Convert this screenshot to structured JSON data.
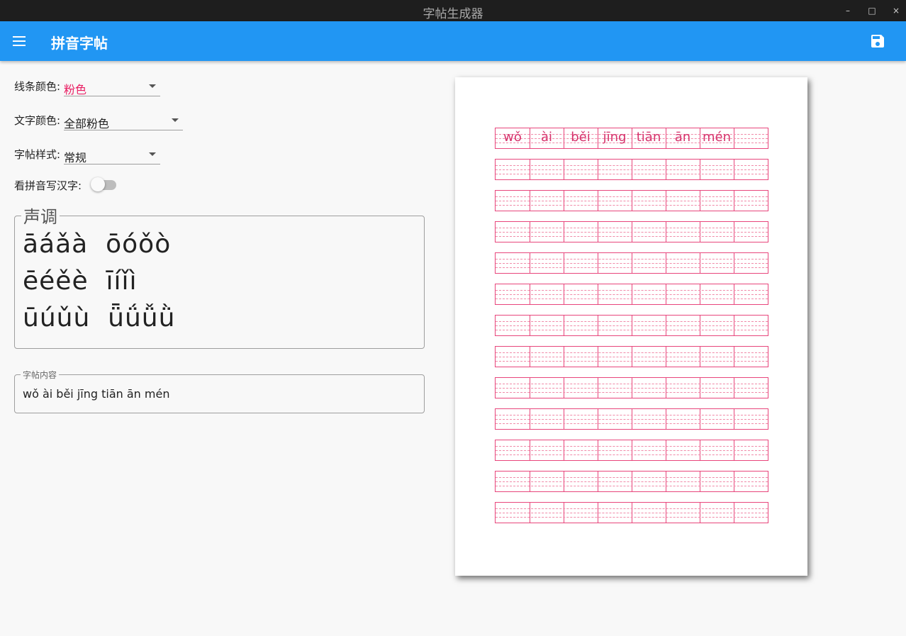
{
  "window": {
    "title": "字帖生成器",
    "controls": {
      "minimize": "–",
      "maximize": "□",
      "close": "×"
    }
  },
  "appbar": {
    "title": "拼音字帖",
    "menu_icon": "menu-icon",
    "save_icon": "save-icon",
    "color": "#2196f3"
  },
  "settings": {
    "line_color": {
      "label": "线条颜色:",
      "value": "粉色",
      "value_color": "#e91e63"
    },
    "text_color": {
      "label": "文字颜色:",
      "value": "全部粉色"
    },
    "style": {
      "label": "字帖样式:",
      "value": "常规"
    },
    "pinyin_to_hanzi": {
      "label": "看拼音写汉字:",
      "on": false
    }
  },
  "tones": {
    "legend": "声调",
    "lines": [
      "āáǎà  ōóǒò",
      "ēéěè  īíǐì",
      "ūúǔù  ǖǘǚǜ"
    ]
  },
  "content": {
    "legend": "字帖内容",
    "value": "wǒ ài běi jīng tiān ān mén"
  },
  "preview": {
    "pinyin": [
      "wǒ",
      "ài",
      "běi",
      "jīng",
      "tiān",
      "ān",
      "mén"
    ],
    "columns": 8,
    "rows": 13,
    "line_color": "#e8467c",
    "text_color": "#d6336c"
  }
}
